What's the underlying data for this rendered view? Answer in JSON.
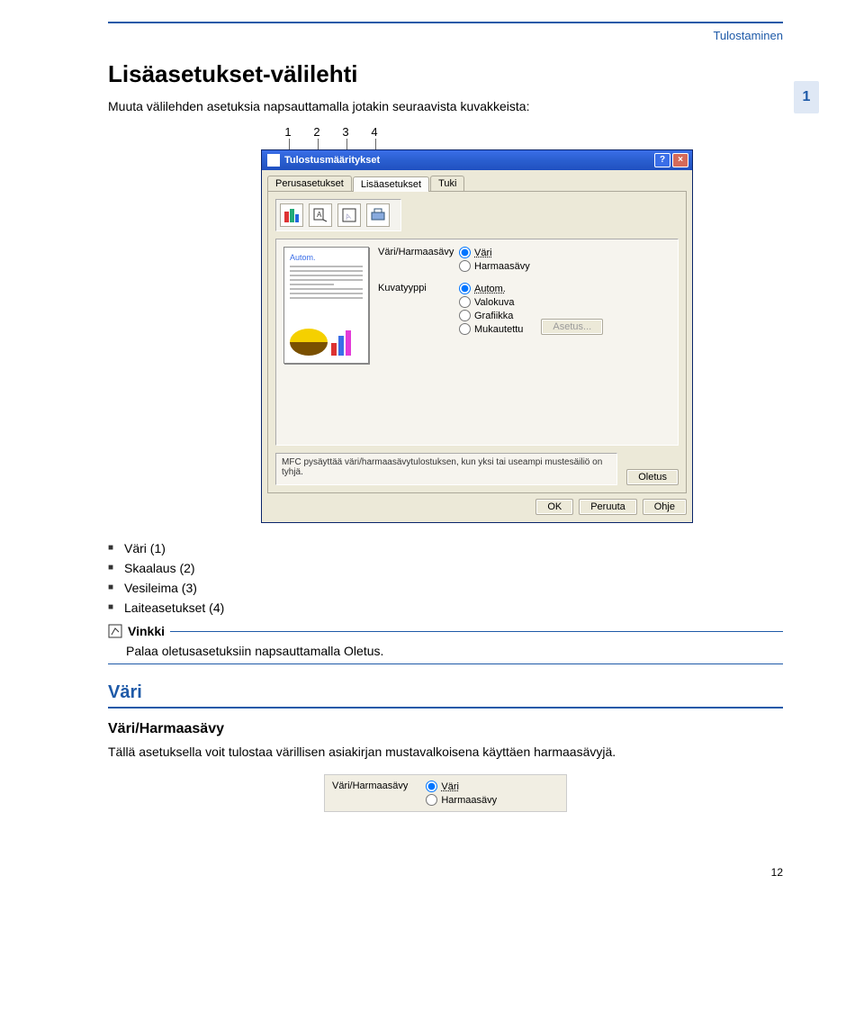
{
  "header": {
    "section": "Tulostaminen",
    "chapter_badge": "1",
    "page_number": "12"
  },
  "heading": "Lisäasetukset-välilehti",
  "intro": "Muuta välilehden asetuksia napsauttamalla jotakin seuraavista kuvakkeista:",
  "callouts": [
    "1",
    "2",
    "3",
    "4"
  ],
  "dialog": {
    "title": "Tulostusmääritykset",
    "tabs": {
      "basic": "Perusasetukset",
      "advanced": "Lisäasetukset",
      "support": "Tuki"
    },
    "preview_label": "Autom.",
    "group1": {
      "label": "Väri/Harmaasävy",
      "options": {
        "color": "Väri",
        "gray": "Harmaasävy"
      }
    },
    "group2": {
      "label": "Kuvatyyppi",
      "options": {
        "auto": "Autom.",
        "photo": "Valokuva",
        "graphics": "Grafiikka",
        "custom": "Mukautettu"
      },
      "settings_btn": "Asetus..."
    },
    "status_msg": "MFC pysäyttää väri/harmaasävytulostuksen, kun yksi tai useampi mustesäiliö on tyhjä.",
    "buttons": {
      "default": "Oletus",
      "ok": "OK",
      "cancel": "Peruuta",
      "help": "Ohje"
    }
  },
  "bullets": {
    "color": "Väri (1)",
    "scaling": "Skaalaus (2)",
    "watermark": "Vesileima (3)",
    "device": "Laiteasetukset (4)"
  },
  "note": {
    "label": "Vinkki",
    "text": "Palaa oletusasetuksiin napsauttamalla Oletus."
  },
  "section_color": {
    "title": "Väri",
    "sub_title": "Väri/Harmaasävy",
    "text": "Tällä asetuksella voit tulostaa värillisen asiakirjan mustavalkoisena käyttäen harmaasävyjä."
  },
  "inset": {
    "label": "Väri/Harmaasävy",
    "options": {
      "color": "Väri",
      "gray": "Harmaasävy"
    }
  }
}
